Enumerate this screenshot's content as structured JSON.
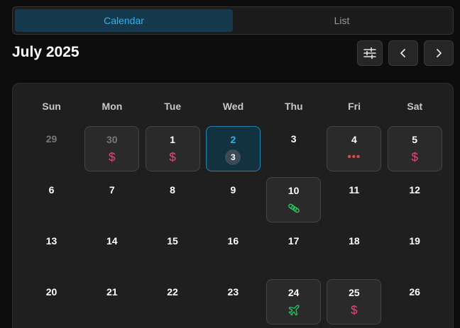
{
  "tabs": [
    {
      "label": "Calendar",
      "active": true
    },
    {
      "label": "List",
      "active": false
    }
  ],
  "header": {
    "month_title": "July 2025",
    "filter_icon": "sliders-icon",
    "prev_icon": "chevron-left-icon",
    "next_icon": "chevron-right-icon"
  },
  "colors": {
    "accent": "#2bb3ee",
    "dollar": "#e8477f",
    "dots": "#e24a4a",
    "green": "#22c55e"
  },
  "weekdays": [
    "Sun",
    "Mon",
    "Tue",
    "Wed",
    "Thu",
    "Fri",
    "Sat"
  ],
  "weeks": [
    [
      {
        "day": "29",
        "muted": true,
        "boxed": false,
        "event": null
      },
      {
        "day": "30",
        "muted": true,
        "boxed": true,
        "event": {
          "type": "dollar",
          "text": "$"
        }
      },
      {
        "day": "1",
        "boxed": true,
        "event": {
          "type": "dollar",
          "text": "$"
        }
      },
      {
        "day": "2",
        "boxed": true,
        "today": true,
        "event": {
          "type": "count",
          "text": "3"
        }
      },
      {
        "day": "3",
        "boxed": false,
        "event": null
      },
      {
        "day": "4",
        "boxed": true,
        "event": {
          "type": "dots",
          "text": "•••"
        }
      },
      {
        "day": "5",
        "boxed": true,
        "event": {
          "type": "dollar",
          "text": "$"
        }
      }
    ],
    [
      {
        "day": "6",
        "boxed": false,
        "event": null
      },
      {
        "day": "7",
        "boxed": false,
        "event": null
      },
      {
        "day": "8",
        "boxed": false,
        "event": null
      },
      {
        "day": "9",
        "boxed": false,
        "event": null
      },
      {
        "day": "10",
        "boxed": true,
        "event": {
          "type": "pills",
          "icon": "pills-icon"
        }
      },
      {
        "day": "11",
        "boxed": false,
        "event": null
      },
      {
        "day": "12",
        "boxed": false,
        "event": null
      }
    ],
    [
      {
        "day": "13",
        "boxed": false,
        "event": null
      },
      {
        "day": "14",
        "boxed": false,
        "event": null
      },
      {
        "day": "15",
        "boxed": false,
        "event": null
      },
      {
        "day": "16",
        "boxed": false,
        "event": null
      },
      {
        "day": "17",
        "boxed": false,
        "event": null
      },
      {
        "day": "18",
        "boxed": false,
        "event": null
      },
      {
        "day": "19",
        "boxed": false,
        "event": null
      }
    ],
    [
      {
        "day": "20",
        "boxed": false,
        "event": null
      },
      {
        "day": "21",
        "boxed": false,
        "event": null
      },
      {
        "day": "22",
        "boxed": false,
        "event": null
      },
      {
        "day": "23",
        "boxed": false,
        "event": null
      },
      {
        "day": "24",
        "boxed": true,
        "event": {
          "type": "plane",
          "icon": "plane-icon"
        }
      },
      {
        "day": "25",
        "boxed": true,
        "event": {
          "type": "dollar",
          "text": "$"
        }
      },
      {
        "day": "26",
        "boxed": false,
        "event": null
      }
    ]
  ]
}
